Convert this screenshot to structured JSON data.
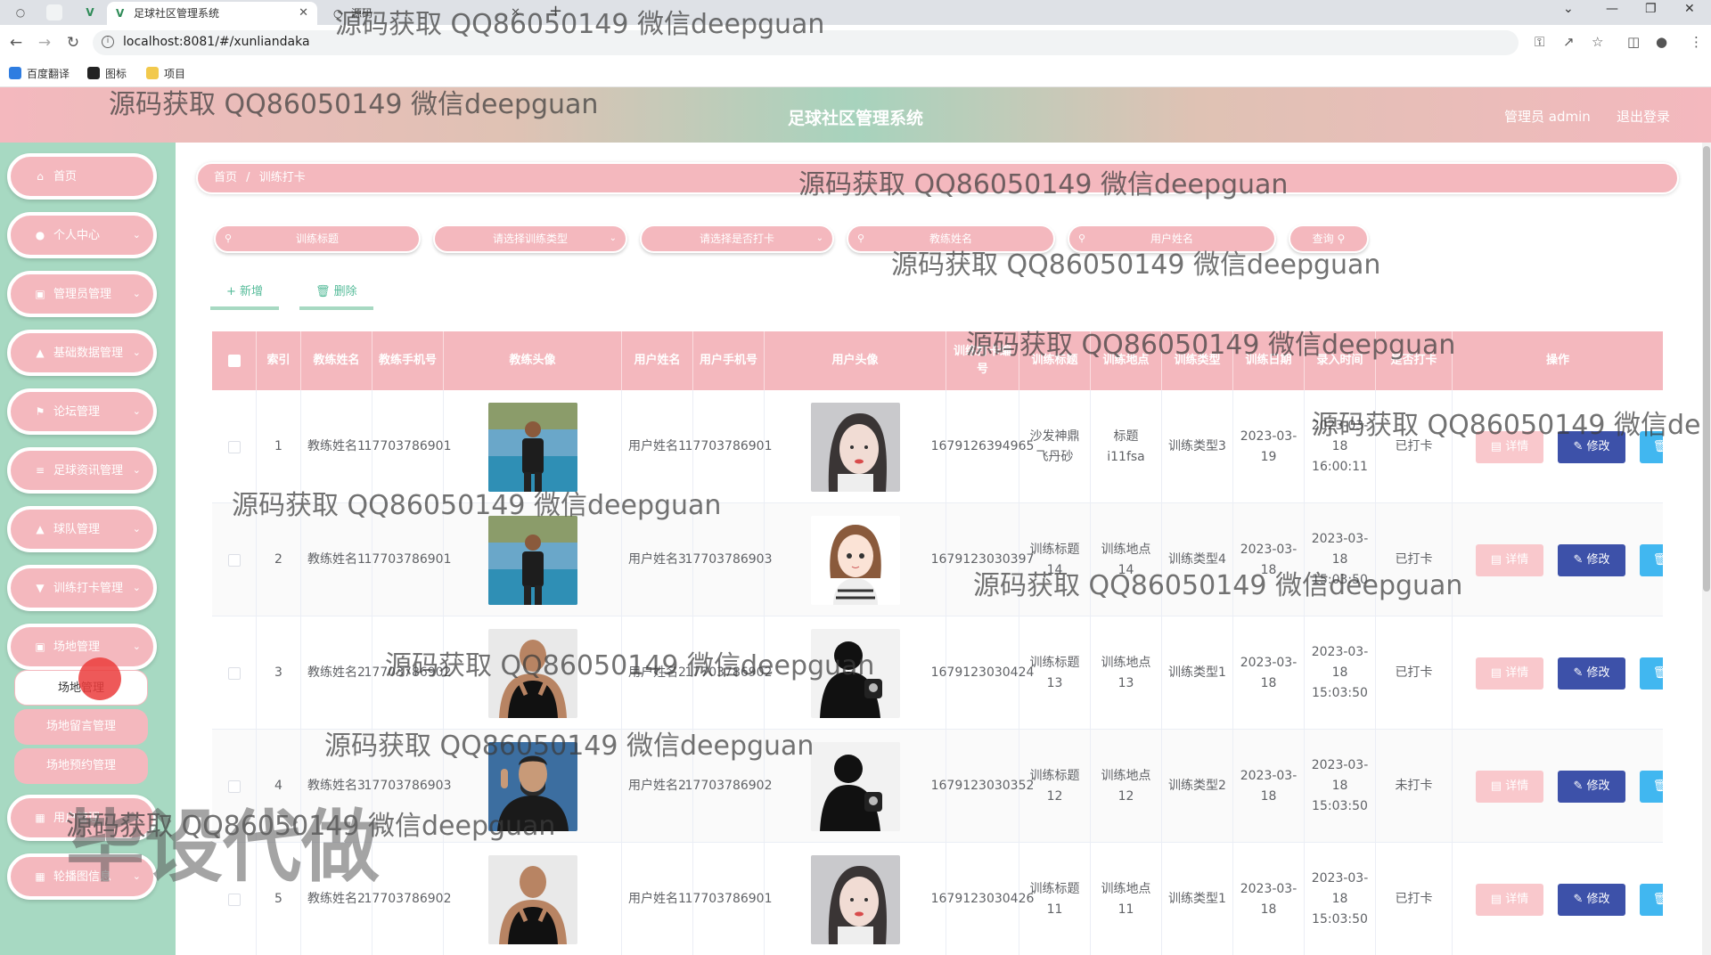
{
  "browser": {
    "tabs": [
      {
        "title": "足球社区管理系统",
        "active": true
      },
      {
        "title": "源码",
        "active": false
      }
    ],
    "url": "localhost:8081/#/xunliandaka",
    "bookmarks": [
      "百度翻译",
      "图标",
      "项目"
    ]
  },
  "header": {
    "title": "足球社区管理系统",
    "user": "管理员 admin",
    "logout": "退出登录"
  },
  "sidebar": {
    "items": [
      {
        "label": "首页",
        "icon": "home-icon"
      },
      {
        "label": "个人中心",
        "icon": "user-icon"
      },
      {
        "label": "管理员管理",
        "icon": "admin-icon"
      },
      {
        "label": "基础数据管理",
        "icon": "data-icon"
      },
      {
        "label": "论坛管理",
        "icon": "flag-icon"
      },
      {
        "label": "足球资讯管理",
        "icon": "news-icon"
      },
      {
        "label": "球队管理",
        "icon": "team-icon"
      },
      {
        "label": "训练打卡管理",
        "icon": "checkin-icon"
      },
      {
        "label": "场地管理",
        "icon": "venue-icon"
      },
      {
        "label": "用户管理",
        "icon": "grid-icon"
      },
      {
        "label": "轮播图信息",
        "icon": "grid-icon"
      }
    ],
    "submenu": [
      "场地管理",
      "场地留言管理",
      "场地预约管理"
    ]
  },
  "breadcrumb": {
    "home": "首页",
    "sep": "/",
    "current": "训练打卡"
  },
  "filters": {
    "title_placeholder": "训练标题",
    "type_placeholder": "请选择训练类型",
    "checked_placeholder": "请选择是否打卡",
    "coach_placeholder": "教练姓名",
    "user_placeholder": "用户姓名",
    "search_label": "查询"
  },
  "actions": {
    "add": "新增",
    "delete": "删除"
  },
  "table": {
    "headers": [
      "索引",
      "教练姓名",
      "教练手机号",
      "教练头像",
      "用户姓名",
      "用户手机号",
      "用户头像",
      "训练打卡编号",
      "训练标题",
      "训练地点",
      "训练类型",
      "训练日期",
      "录入时间",
      "是否打卡",
      "操作"
    ],
    "ops": {
      "detail": "详情",
      "edit": "修改",
      "del": "删除"
    },
    "rows": [
      {
        "index": "1",
        "coach": "教练姓名1",
        "coach_phone": "17703786901",
        "user": "用户姓名1",
        "user_phone": "17703786901",
        "code": "1679126394965",
        "title": "沙发神鼎飞丹砂",
        "place": "标题i11fsa",
        "type": "训练类型3",
        "date": "2023-03-19",
        "created": "2023-03-18 16:00:11",
        "checked": "已打卡",
        "coach_avatar": "pool",
        "user_avatar": "girl"
      },
      {
        "index": "2",
        "coach": "教练姓名1",
        "coach_phone": "17703786901",
        "user": "用户姓名3",
        "user_phone": "17703786903",
        "code": "1679123030397",
        "title": "训练标题14",
        "place": "训练地点14",
        "type": "训练类型4",
        "date": "2023-03-18",
        "created": "2023-03-18 15:03:50",
        "checked": "已打卡",
        "coach_avatar": "pool",
        "user_avatar": "cartoon"
      },
      {
        "index": "3",
        "coach": "教练姓名2",
        "coach_phone": "17703786902",
        "user": "用户姓名2",
        "user_phone": "17703786902",
        "code": "1679123030424",
        "title": "训练标题13",
        "place": "训练地点13",
        "type": "训练类型1",
        "date": "2023-03-18",
        "created": "2023-03-18 15:03:50",
        "checked": "已打卡",
        "coach_avatar": "bald",
        "user_avatar": "silhouette"
      },
      {
        "index": "4",
        "coach": "教练姓名3",
        "coach_phone": "17703786903",
        "user": "用户姓名2",
        "user_phone": "17703786902",
        "code": "1679123030352",
        "title": "训练标题12",
        "place": "训练地点12",
        "type": "训练类型2",
        "date": "2023-03-18",
        "created": "2023-03-18 15:03:50",
        "checked": "未打卡",
        "coach_avatar": "bearded",
        "user_avatar": "silhouette"
      },
      {
        "index": "5",
        "coach": "教练姓名2",
        "coach_phone": "17703786902",
        "user": "用户姓名1",
        "user_phone": "17703786901",
        "code": "1679123030426",
        "title": "训练标题11",
        "place": "训练地点11",
        "type": "训练类型1",
        "date": "2023-03-18",
        "created": "2023-03-18 15:03:50",
        "checked": "已打卡",
        "coach_avatar": "bald",
        "user_avatar": "girl"
      }
    ]
  },
  "watermarks": {
    "text": "源码获取 QQ86050149 微信deepguan",
    "big": "毕设代做"
  },
  "colors": {
    "pink": "#f4b8be",
    "mint": "#a7d9c2",
    "edit_blue": "#3d51a9",
    "delete_blue": "#41b7f0"
  }
}
